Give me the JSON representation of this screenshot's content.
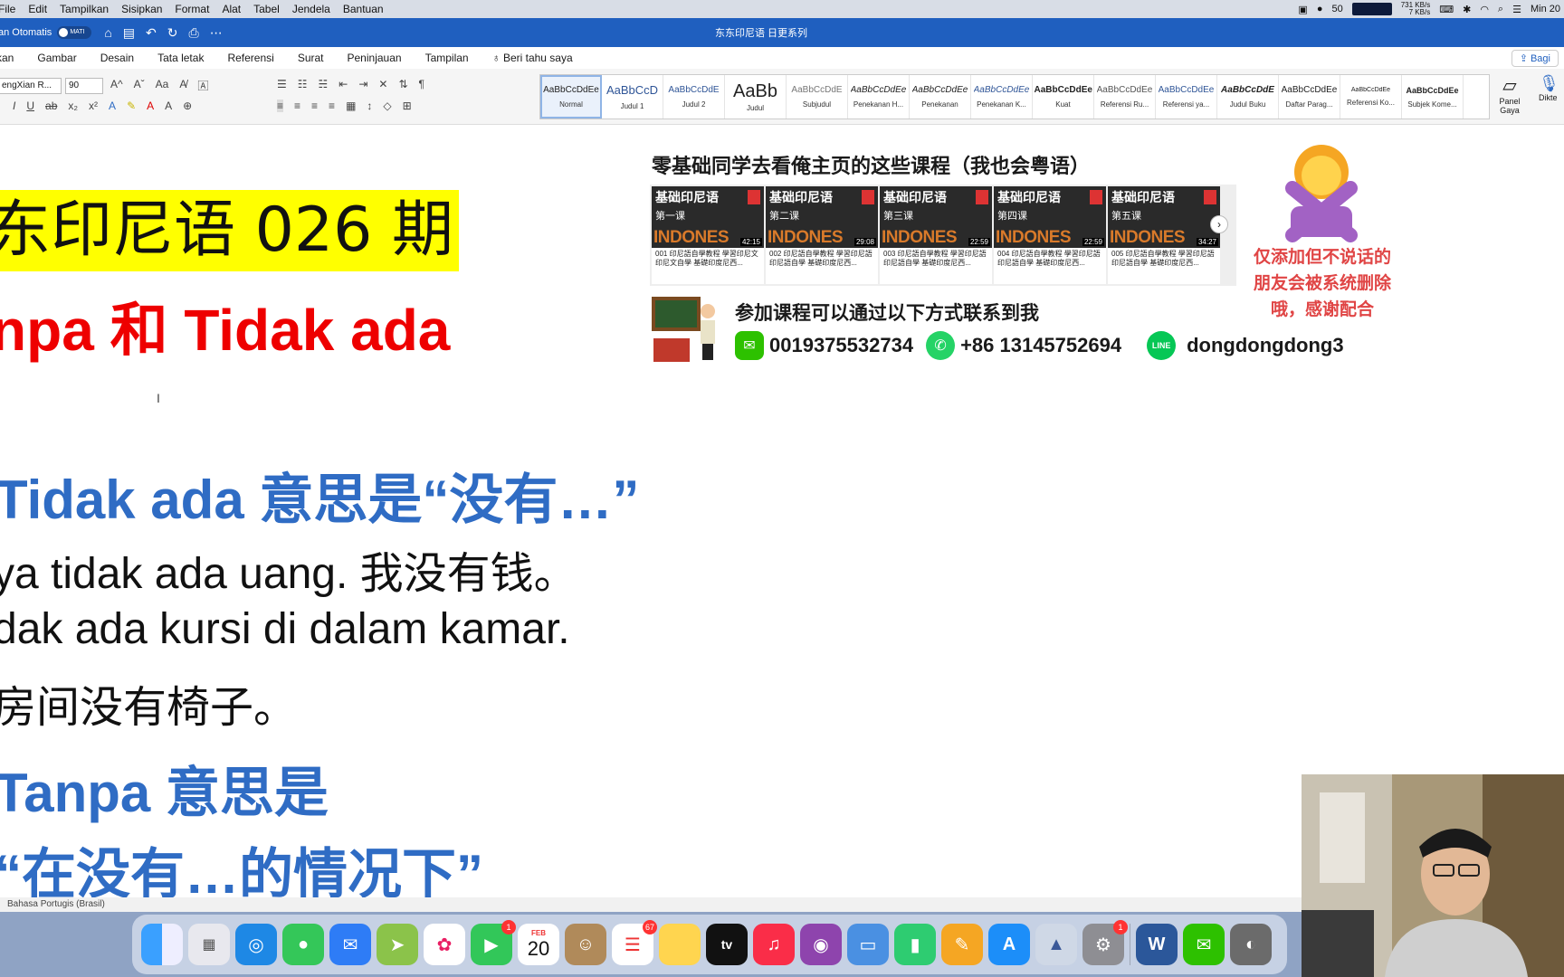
{
  "menubar": {
    "items": [
      "File",
      "Edit",
      "Tampilkan",
      "Sisipkan",
      "Format",
      "Alat",
      "Tabel",
      "Jendela",
      "Bantuan"
    ],
    "battery": "50",
    "net_up": "731 KB/s",
    "net_down": "7 KB/s",
    "clock": "Min 20"
  },
  "titlebar": {
    "autosave_label": "an Otomatis",
    "toggle_state": "MATI",
    "doc_title": "东东印尼语 日更系列"
  },
  "ribbon": {
    "tabs": [
      "kan",
      "Gambar",
      "Desain",
      "Tata letak",
      "Referensi",
      "Surat",
      "Peninjauan",
      "Tampilan"
    ],
    "tell_me": "Beri tahu saya",
    "share": "Bagi",
    "font_name": "engXian R...",
    "font_size": "90",
    "styles": [
      {
        "preview": "AaBbCcDdEe",
        "name": "Normal"
      },
      {
        "preview": "AaBbCcD",
        "name": "Judul 1"
      },
      {
        "preview": "AaBbCcDdE",
        "name": "Judul 2"
      },
      {
        "preview": "AaBb",
        "name": "Judul"
      },
      {
        "preview": "AaBbCcDdE",
        "name": "Subjudul"
      },
      {
        "preview": "AaBbCcDdEe",
        "name": "Penekanan H..."
      },
      {
        "preview": "AaBbCcDdEe",
        "name": "Penekanan"
      },
      {
        "preview": "AaBbCcDdEe",
        "name": "Penekanan K..."
      },
      {
        "preview": "AaBbCcDdEe",
        "name": "Kuat"
      },
      {
        "preview": "AaBbCcDdEe",
        "name": "Referensi Ru..."
      },
      {
        "preview": "AaBbCcDdEe",
        "name": "Referensi ya..."
      },
      {
        "preview": "AaBbCcDdE",
        "name": "Judul Buku"
      },
      {
        "preview": "AaBbCcDdEe",
        "name": "Daftar Parag..."
      },
      {
        "preview": "AaBbCcDdEe",
        "name": "Referensi Ko..."
      },
      {
        "preview": "AaBbCcDdEe",
        "name": "Subjek Kome..."
      }
    ],
    "panel_gaya": "Panel Gaya",
    "dikte": "Dikte"
  },
  "document": {
    "heading": "东印尼语 026 期",
    "subheading": "npa 和 Tidak ada",
    "line1": "Tidak ada 意思是“没有…”",
    "line2": "ya tidak ada uang. 我没有钱。",
    "line3": "dak ada kursi di dalam kamar.",
    "line4": "房间没有椅子。",
    "line5": "Tanpa 意思是",
    "line6": "“在没有…的情况下”"
  },
  "promo": {
    "title": "零基础同学去看俺主页的这些课程（我也会粤语）",
    "cards": [
      {
        "title": "基础印尼语",
        "lesson": "第一课",
        "word": "INDONES",
        "duration": "42:15",
        "caption": "001 印尼語自學教程 學習印尼文 印尼文自學 基礎印度尼西..."
      },
      {
        "title": "基础印尼语",
        "lesson": "第二课",
        "word": "INDONES",
        "duration": "29:08",
        "caption": "002 印尼語自學教程 學習印尼語 印尼語自學 基礎印度尼西..."
      },
      {
        "title": "基础印尼语",
        "lesson": "第三课",
        "word": "INDONES",
        "duration": "22:59",
        "caption": "003 印尼語自學教程 學習印尼語 印尼語自學 基礎印度尼西..."
      },
      {
        "title": "基础印尼语",
        "lesson": "第四课",
        "word": "INDONES",
        "duration": "22:59",
        "caption": "004 印尼語自學教程 學習印尼語 印尼語自學 基礎印度尼西..."
      },
      {
        "title": "基础印尼语",
        "lesson": "第五课",
        "word": "INDONES",
        "duration": "34:27",
        "caption": "005 印尼語自學教程 學習印尼語 印尼語自學 基礎印度尼西..."
      }
    ],
    "contact_title": "参加课程可以通过以下方式联系到我",
    "wechat": "0019375532734",
    "whatsapp": "+86 13145752694",
    "line_id": "dongdongdong3",
    "line_icon": "LINE",
    "warning": "仅添加但不说话的朋友会被系统删除哦，感谢配合"
  },
  "statusbar": {
    "language": "Bahasa Portugis (Brasil)"
  },
  "dock": {
    "calendar_month": "FEB",
    "calendar_day": "20",
    "facetime_badge": "1",
    "reminders_badge": "67",
    "settings_badge": "1",
    "tv_label": "tv",
    "word_label": "W"
  }
}
